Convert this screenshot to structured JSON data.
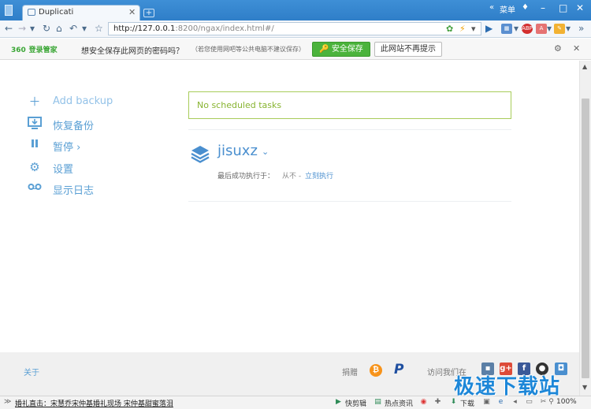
{
  "browser": {
    "tab_title": "Duplicati",
    "tab_close": "✕",
    "new_tab": "+",
    "menu_label": "菜单",
    "url_host": "http://127.0.0.1",
    "url_path": ":8200/ngax/index.html#/"
  },
  "password_bar": {
    "logo_number": "360",
    "logo_text": "登录管家",
    "question": "想安全保存此网页的密码吗？",
    "hint": "（若您使用网吧等公共电脑不建议保存）",
    "save_label": "安全保存",
    "never_label": "此网站不再提示"
  },
  "sidebar": {
    "items": [
      {
        "label": "Add backup",
        "icon": "plus-icon"
      },
      {
        "label": "恢复备份",
        "icon": "monitor-download-icon"
      },
      {
        "label": "暂停",
        "icon": "pause-icon",
        "suffix": "›"
      },
      {
        "label": "设置",
        "icon": "gear-icon"
      },
      {
        "label": "显示日志",
        "icon": "tape-icon"
      }
    ]
  },
  "main": {
    "scheduled_text": "No scheduled tasks",
    "job": {
      "name": "jisuxz",
      "last_run_label": "最后成功执行于：",
      "last_run_value": "从不 -",
      "run_now": "立刻执行"
    }
  },
  "footer": {
    "about": "关于",
    "donate": "捐赠",
    "bitcoin": "₿",
    "paypal": "P",
    "visit": "访问我们在"
  },
  "statusbar": {
    "news": "婚礼直击：宋慧乔宋仲基婚礼现场 宋仲基甜蜜落泪",
    "items": [
      "快剪辑",
      "热点资讯",
      "下载"
    ],
    "zoom": "100%"
  },
  "watermark": "极速下载站",
  "colors": {
    "accent": "#5a9fd4",
    "schedule_border": "#a8cc5a",
    "save_green": "#4bb33c"
  }
}
